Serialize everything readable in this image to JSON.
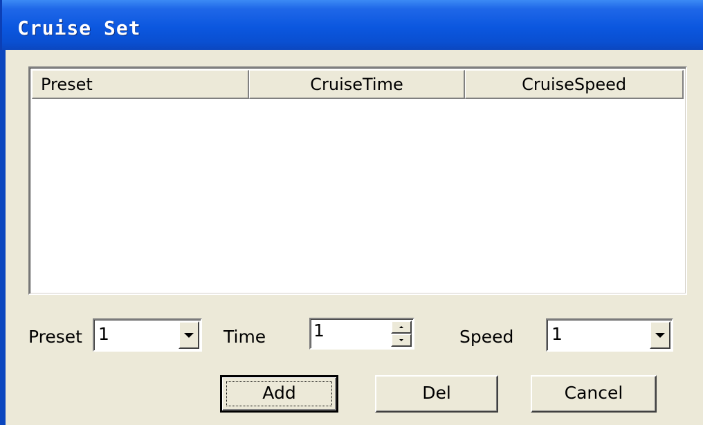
{
  "window": {
    "title": "Cruise Set"
  },
  "list": {
    "columns": [
      "Preset",
      "CruiseTime",
      "CruiseSpeed"
    ],
    "rows": []
  },
  "controls": {
    "preset_label": "Preset",
    "preset_value": "1",
    "time_label": "Time",
    "time_value": "1",
    "speed_label": "Speed",
    "speed_value": "1"
  },
  "buttons": {
    "add": "Add",
    "del": "Del",
    "cancel": "Cancel"
  },
  "colors": {
    "titlebar": "#0b57df",
    "dialog_bg": "#ece9d8",
    "list_bg": "#ffffff"
  }
}
